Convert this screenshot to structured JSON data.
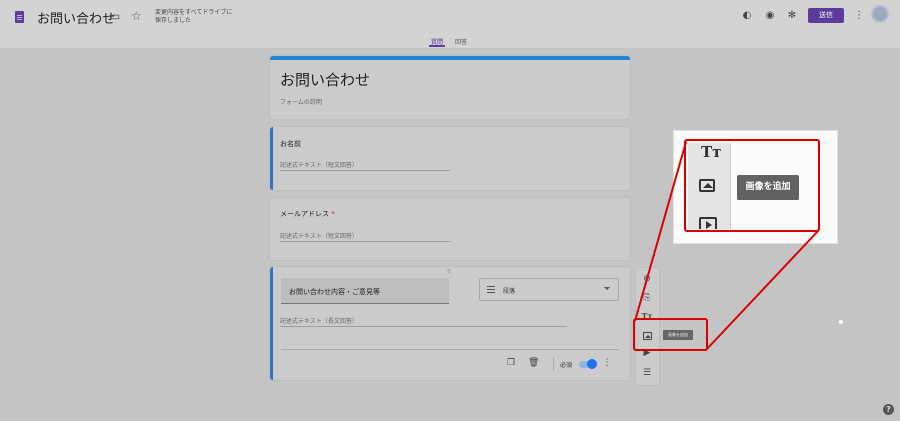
{
  "header": {
    "form_title": "お問い合わせ",
    "folder_icon": "folder-icon",
    "star_icon": "star-icon",
    "save_status": "変更内容をすべてドライブに\n保存しました",
    "palette_icon": "palette-icon",
    "preview_icon": "eye-icon",
    "settings_icon": "gear-icon",
    "send_label": "送信",
    "more_icon": "more-vert-icon",
    "brand_color": "#5b3c9a"
  },
  "tabs": [
    {
      "label": "質問",
      "active": true
    },
    {
      "label": "回答",
      "active": false
    }
  ],
  "form": {
    "title": "お問い合わせ",
    "description": "フォームの説明",
    "accent_color": "#1e88d6"
  },
  "questions": [
    {
      "title": "お名前",
      "required": false,
      "hint": "記述式テキスト（短文回答）"
    },
    {
      "title": "メールアドレス",
      "required": true,
      "required_mark": "*",
      "hint": "記述式テキスト（短文回答）"
    },
    {
      "title": "お問い合わせ内容・ご意見等",
      "type_label": "段落",
      "hint": "記述式テキスト（長文回答）",
      "required_label": "必須",
      "required_on": true
    }
  ],
  "toolbar": {
    "items": [
      "add-question-icon",
      "import-questions-icon",
      "add-title-icon",
      "add-image-icon",
      "add-video-icon",
      "add-section-icon"
    ],
    "tooltip": "画像を追加"
  },
  "zoom": {
    "tooltip": "画像を追加",
    "title_glyph": "Tт"
  },
  "help_glyph": "?"
}
